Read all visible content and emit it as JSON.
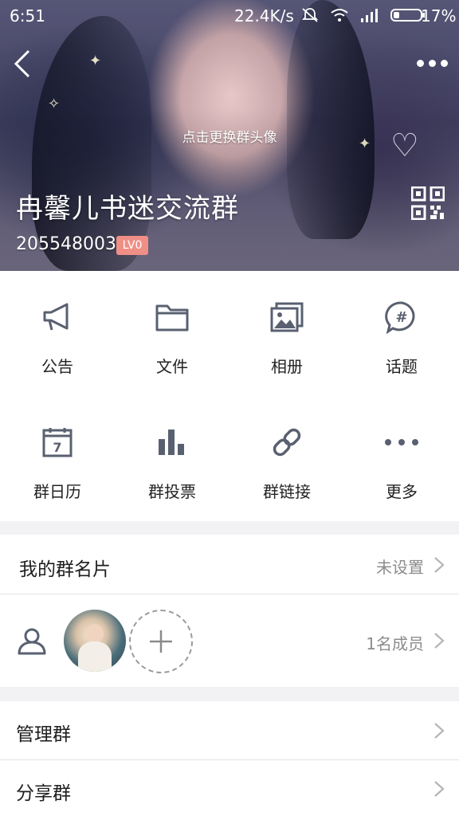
{
  "status_bar": {
    "time": "6:51",
    "net_speed": "22.4K/s",
    "battery_pct": "17%",
    "icons": [
      "mute-icon",
      "wifi-icon",
      "signal-icon",
      "battery-icon"
    ]
  },
  "header": {
    "change_avatar_hint": "点击更换群头像",
    "group_name": "冉馨儿书迷交流群",
    "group_id": "205548003",
    "level": "LV0"
  },
  "grid": {
    "items": [
      {
        "label": "公告",
        "icon": "megaphone-icon"
      },
      {
        "label": "文件",
        "icon": "folder-icon"
      },
      {
        "label": "相册",
        "icon": "album-icon"
      },
      {
        "label": "话题",
        "icon": "topic-icon"
      },
      {
        "label": "群日历",
        "icon": "calendar-icon"
      },
      {
        "label": "群投票",
        "icon": "vote-icon"
      },
      {
        "label": "群链接",
        "icon": "link-icon"
      },
      {
        "label": "更多",
        "icon": "more-icon"
      }
    ],
    "calendar_day": "7"
  },
  "my_card": {
    "label": "我的群名片",
    "value": "未设置"
  },
  "members": {
    "count_label": "1名成员"
  },
  "manage": {
    "label": "管理群"
  },
  "share": {
    "label": "分享群"
  },
  "colors": {
    "icon_gray": "#596070",
    "badge": "#f08f86",
    "divider": "#e4e4e6"
  }
}
